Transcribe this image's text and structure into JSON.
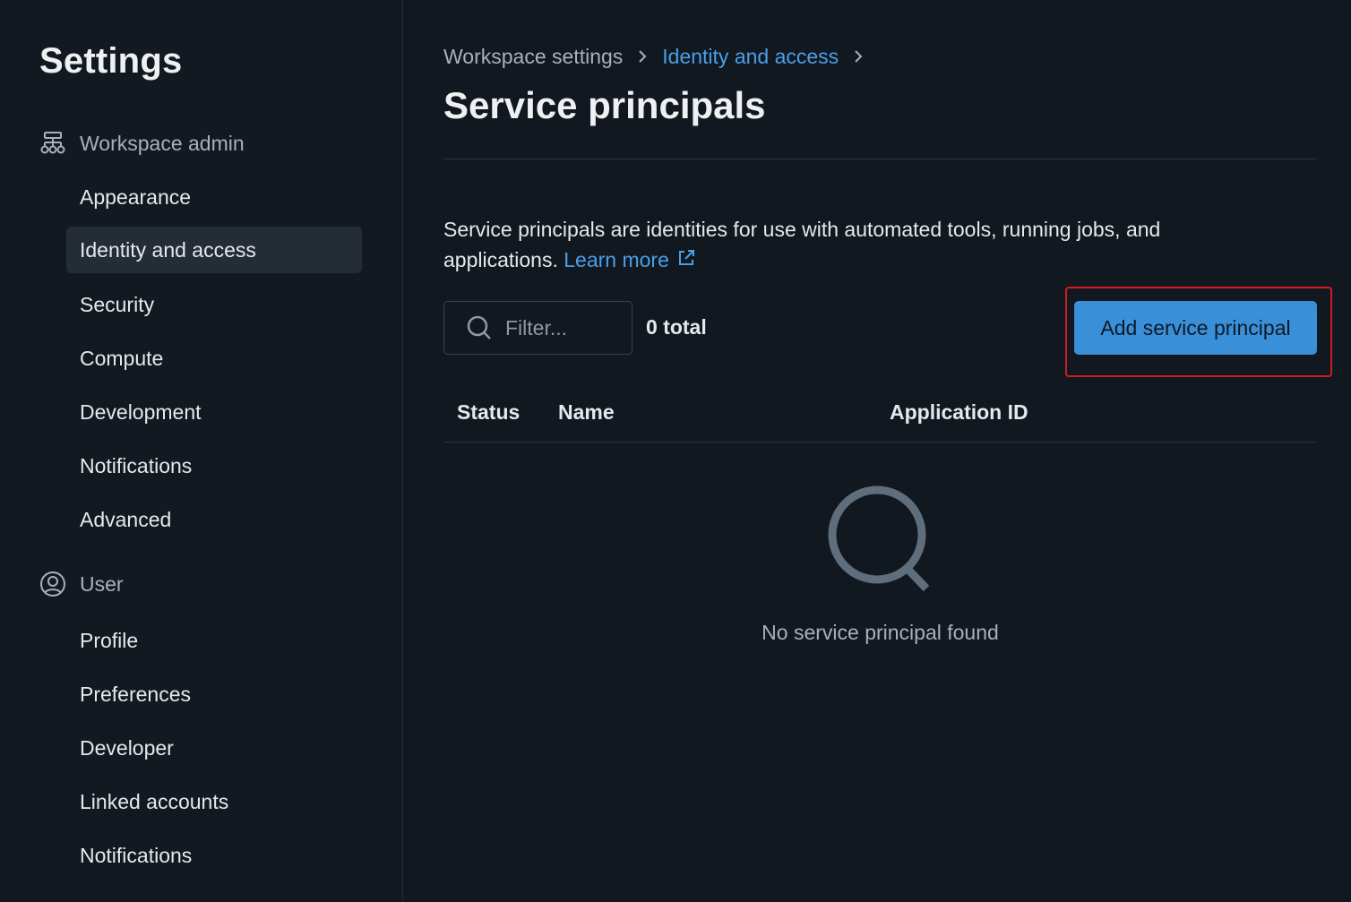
{
  "sidebar": {
    "title": "Settings",
    "workspace_section": {
      "label": "Workspace admin",
      "icon": "workspace-admin-icon",
      "items": [
        {
          "label": "Appearance",
          "active": false
        },
        {
          "label": "Identity and access",
          "active": true
        },
        {
          "label": "Security",
          "active": false
        },
        {
          "label": "Compute",
          "active": false
        },
        {
          "label": "Development",
          "active": false
        },
        {
          "label": "Notifications",
          "active": false
        },
        {
          "label": "Advanced",
          "active": false
        }
      ]
    },
    "user_section": {
      "label": "User",
      "icon": "user-circle-icon",
      "items": [
        {
          "label": "Profile"
        },
        {
          "label": "Preferences"
        },
        {
          "label": "Developer"
        },
        {
          "label": "Linked accounts"
        },
        {
          "label": "Notifications"
        }
      ]
    }
  },
  "breadcrumb": {
    "items": [
      "Workspace settings",
      "Identity and access"
    ]
  },
  "page": {
    "title": "Service principals",
    "description": "Service principals are identities for use with automated tools, running jobs, and applications.",
    "learn_more": "Learn more"
  },
  "toolbar": {
    "filter_placeholder": "Filter...",
    "filter_value": "",
    "total": "0 total",
    "add_button": "Add service principal"
  },
  "table": {
    "columns": [
      "Status",
      "Name",
      "Application ID"
    ],
    "rows": []
  },
  "empty_state": {
    "text": "No service principal found",
    "icon": "search-icon"
  },
  "colors": {
    "background": "#121820",
    "accent": "#3a8fd9",
    "link": "#4a9fe8",
    "highlight": "#d01c1c"
  }
}
